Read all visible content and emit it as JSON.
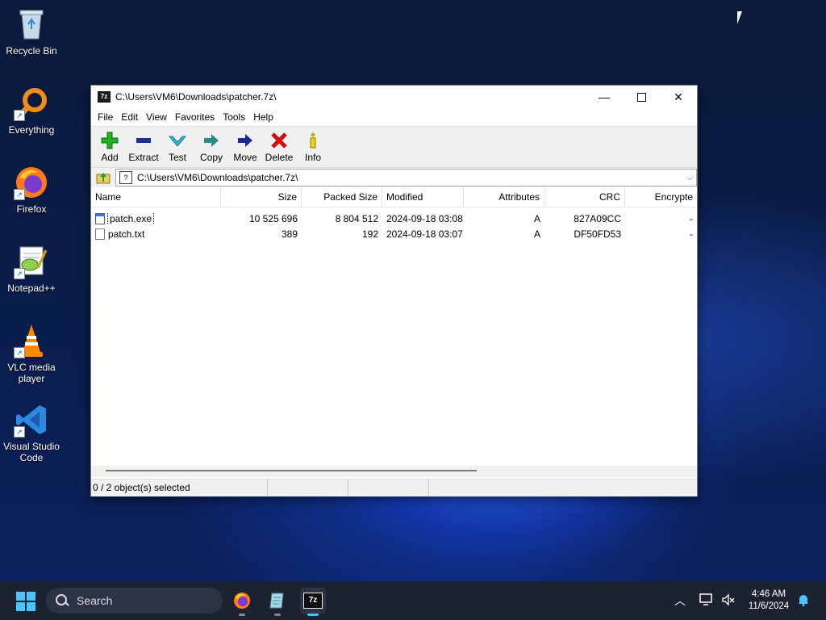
{
  "desktop": {
    "icons": [
      {
        "label": "Recycle Bin",
        "icon": "recycle-bin-icon"
      },
      {
        "label": "Everything",
        "icon": "everything-search-icon"
      },
      {
        "label": "Firefox",
        "icon": "firefox-icon"
      },
      {
        "label": "Notepad++",
        "icon": "notepad-plus-plus-icon"
      },
      {
        "label": "VLC media player",
        "icon": "vlc-icon"
      },
      {
        "label": "Visual Studio Code",
        "icon": "vscode-icon"
      }
    ]
  },
  "window": {
    "title": "C:\\Users\\VM6\\Downloads\\patcher.7z\\",
    "app_icon": "7z",
    "menu": [
      "File",
      "Edit",
      "View",
      "Favorites",
      "Tools",
      "Help"
    ],
    "toolbar": [
      {
        "label": "Add",
        "icon": "plus-icon",
        "color": "#22b022"
      },
      {
        "label": "Extract",
        "icon": "minus-icon",
        "color": "#1a2fa0"
      },
      {
        "label": "Test",
        "icon": "check-icon",
        "color": "#2aa8c0"
      },
      {
        "label": "Copy",
        "icon": "copy-arrow-icon",
        "color": "#2a8a8a"
      },
      {
        "label": "Move",
        "icon": "move-arrow-icon",
        "color": "#1a2a90"
      },
      {
        "label": "Delete",
        "icon": "delete-x-icon",
        "color": "#d01010"
      },
      {
        "label": "Info",
        "icon": "info-icon",
        "color": "#b8a000"
      }
    ],
    "address": "C:\\Users\\VM6\\Downloads\\patcher.7z\\",
    "columns": [
      "Name",
      "Size",
      "Packed Size",
      "Modified",
      "Attributes",
      "CRC",
      "Encrypte"
    ],
    "files": [
      {
        "name": "patch.exe",
        "size": "10 525 696",
        "packed": "8 804 512",
        "modified": "2024-09-18 03:08",
        "attr": "A",
        "crc": "827A09CC",
        "enc": "-"
      },
      {
        "name": "patch.txt",
        "size": "389",
        "packed": "192",
        "modified": "2024-09-18 03:07",
        "attr": "A",
        "crc": "DF50FD53",
        "enc": "-"
      }
    ],
    "status": "0 / 2 object(s) selected"
  },
  "taskbar": {
    "search_placeholder": "Search",
    "time": "4:46 AM",
    "date": "11/6/2024",
    "accent": "#4cc2ff"
  }
}
